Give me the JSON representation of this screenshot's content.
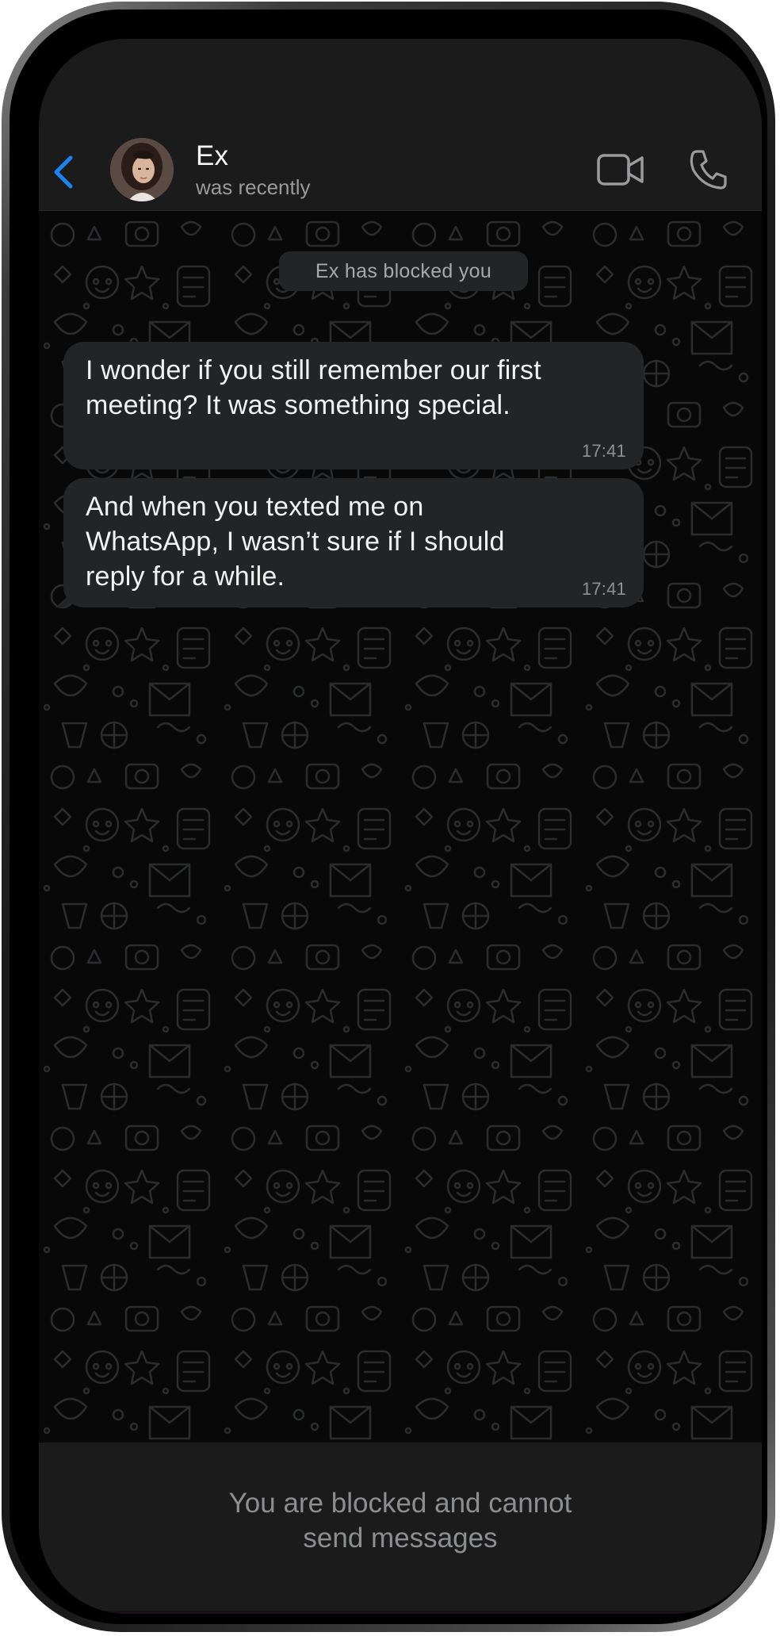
{
  "header": {
    "back_icon": "chevron-left-icon",
    "contact_name": "Ex",
    "contact_status": "was recently",
    "video_icon": "video-camera-icon",
    "call_icon": "phone-icon",
    "accent_color": "#1a84f0"
  },
  "chat": {
    "system_notice": "Ex has blocked you",
    "messages": [
      {
        "text": "I wonder if you still remember our first meeting? It was something special.",
        "time": "17:41"
      },
      {
        "text": "And when you texted me on WhatsApp, I wasn’t sure if I should reply for a while.",
        "time": "17:41"
      }
    ]
  },
  "footer": {
    "blocked_message": "You are blocked and cannot\nsend messages"
  }
}
